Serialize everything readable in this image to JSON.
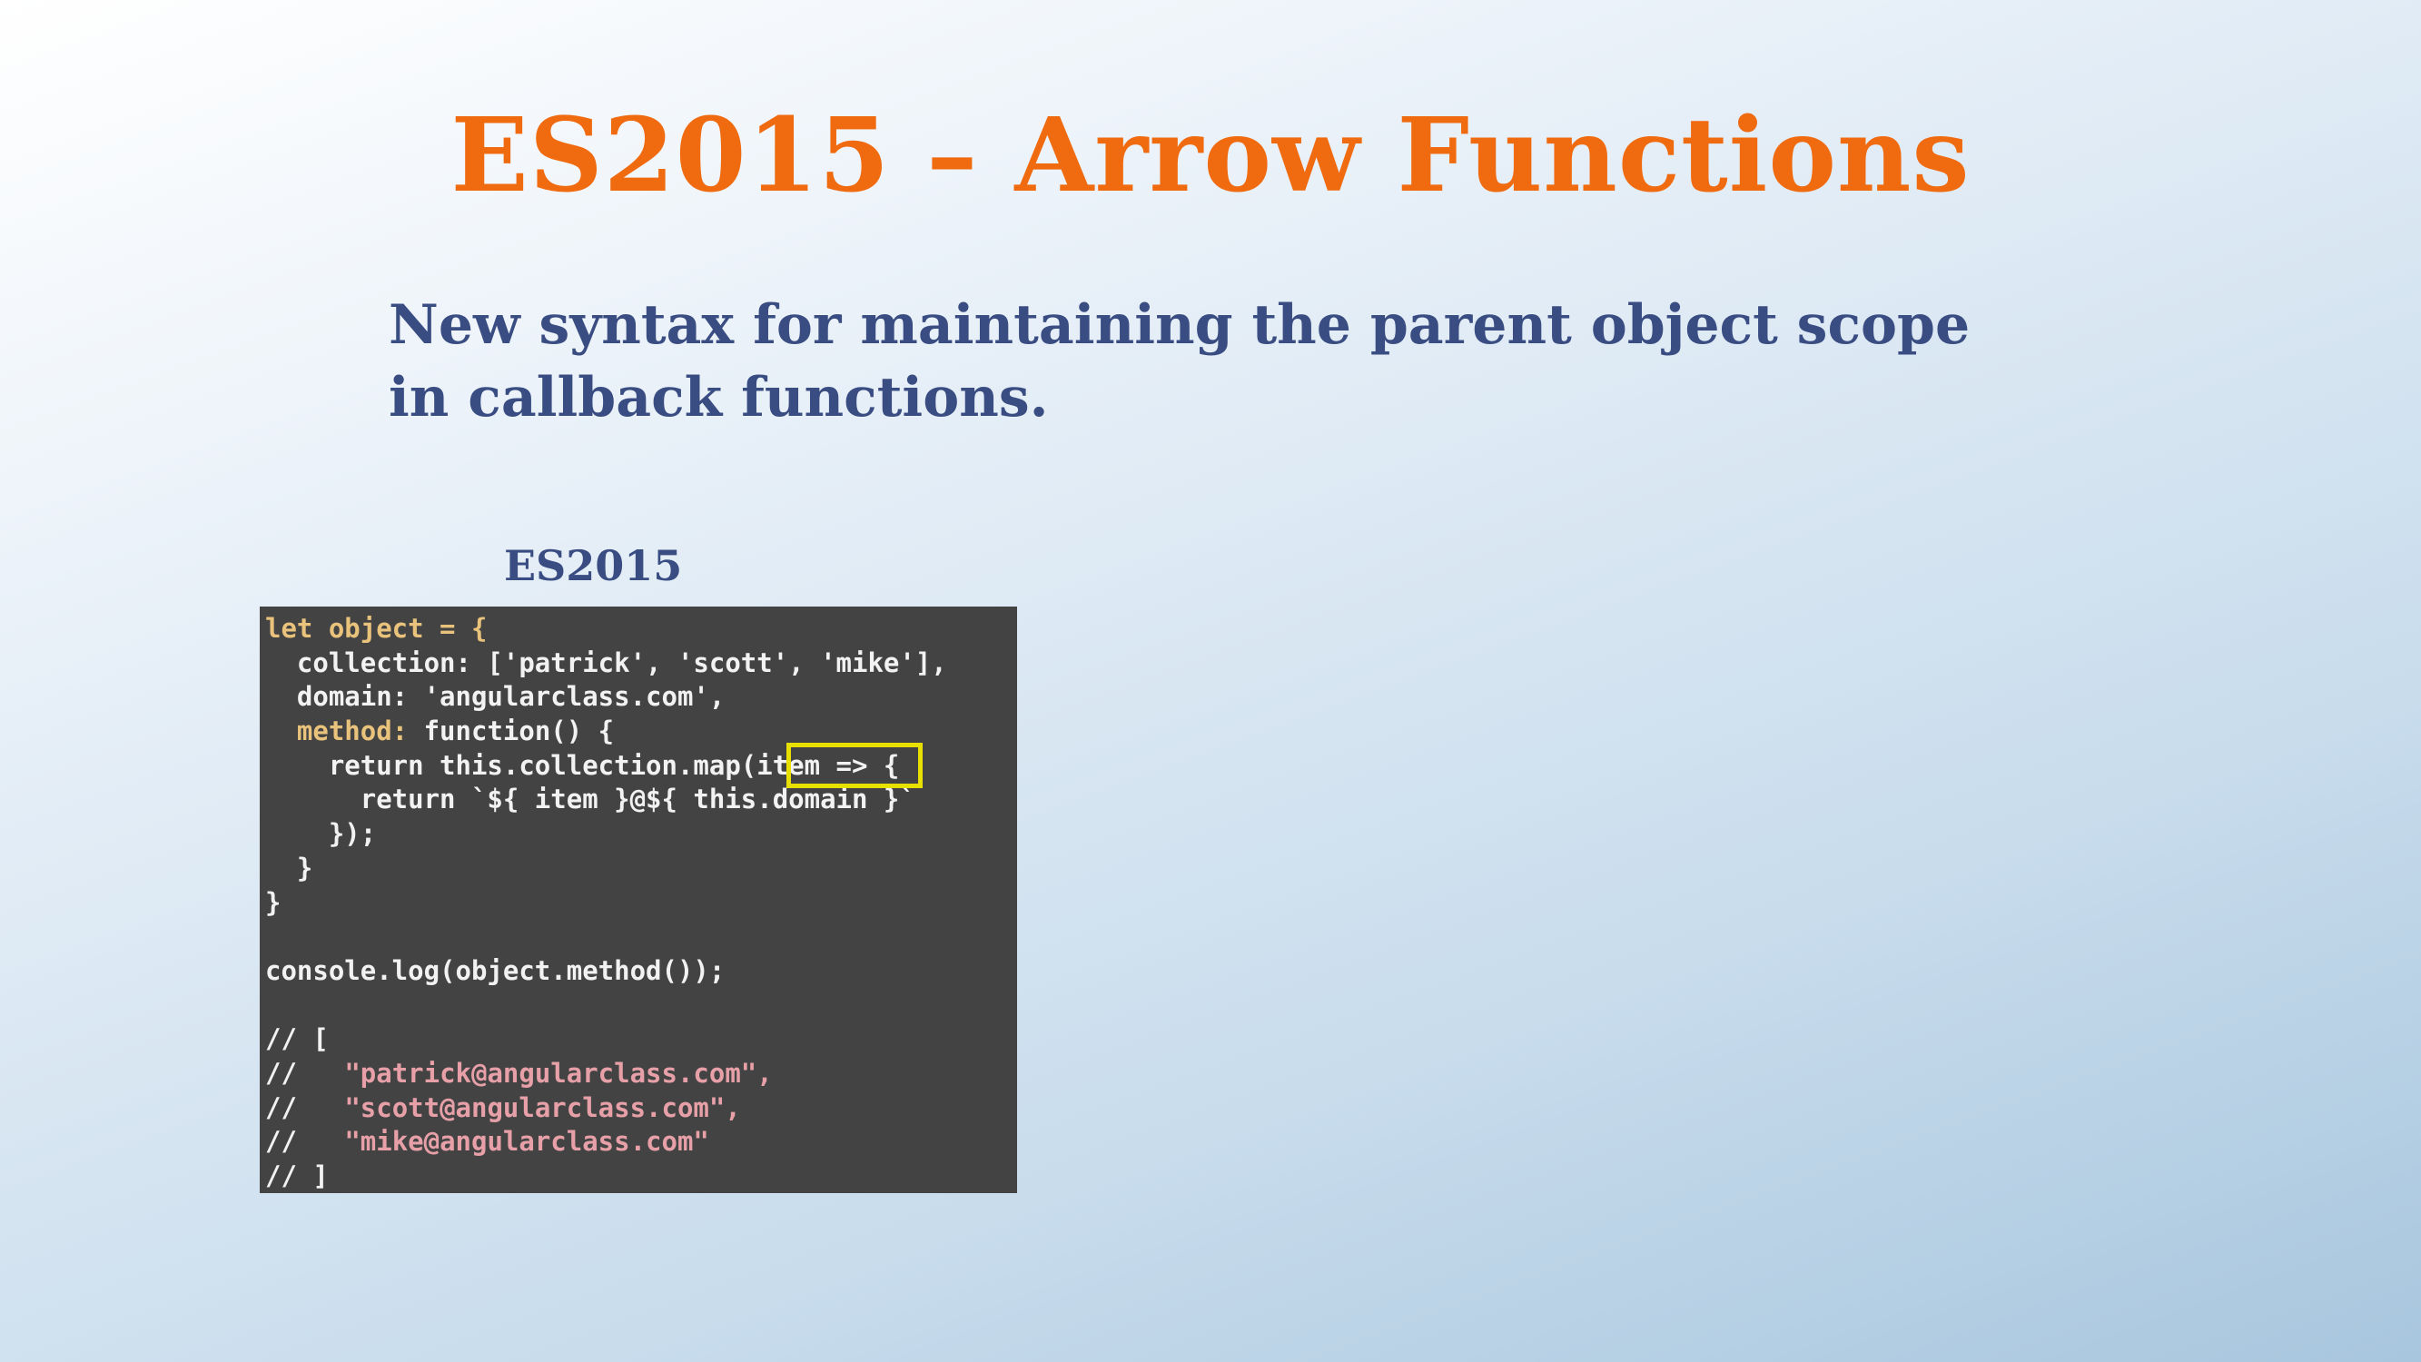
{
  "slide": {
    "title": "ES2015 – Arrow Functions",
    "subtitle": "New syntax for maintaining the parent object scope in callback functions.",
    "code_label": "ES2015"
  },
  "code": {
    "lines": [
      [
        {
          "t": "let object = {",
          "c": "kw"
        }
      ],
      [
        {
          "t": "  collection: ['patrick', 'scott', 'mike'],",
          "c": "str"
        }
      ],
      [
        {
          "t": "  domain: 'angularclass.com',",
          "c": "str"
        }
      ],
      [
        {
          "t": "  ",
          "c": "str"
        },
        {
          "t": "method:",
          "c": "kw"
        },
        {
          "t": " function() {",
          "c": "str"
        }
      ],
      [
        {
          "t": "    return this.collection.map(item => {",
          "c": "str"
        }
      ],
      [
        {
          "t": "      return `${ item }@${ this.domain }`",
          "c": "str"
        }
      ],
      [
        {
          "t": "    });",
          "c": "str"
        }
      ],
      [
        {
          "t": "  }",
          "c": "str"
        }
      ],
      [
        {
          "t": "}",
          "c": "str"
        }
      ],
      [
        {
          "t": "",
          "c": "str"
        }
      ],
      [
        {
          "t": "console.log(object.method());",
          "c": "str"
        }
      ],
      [
        {
          "t": "",
          "c": "str"
        }
      ],
      [
        {
          "t": "// [",
          "c": "com"
        }
      ],
      [
        {
          "t": "//   ",
          "c": "com"
        },
        {
          "t": "\"patrick@angularclass.com\",",
          "c": "pink"
        }
      ],
      [
        {
          "t": "//   ",
          "c": "com"
        },
        {
          "t": "\"scott@angularclass.com\",",
          "c": "pink"
        }
      ],
      [
        {
          "t": "//   ",
          "c": "com"
        },
        {
          "t": "\"mike@angularclass.com\"",
          "c": "pink"
        }
      ],
      [
        {
          "t": "// ]",
          "c": "com"
        }
      ]
    ],
    "highlight_color": "#e8e000"
  }
}
